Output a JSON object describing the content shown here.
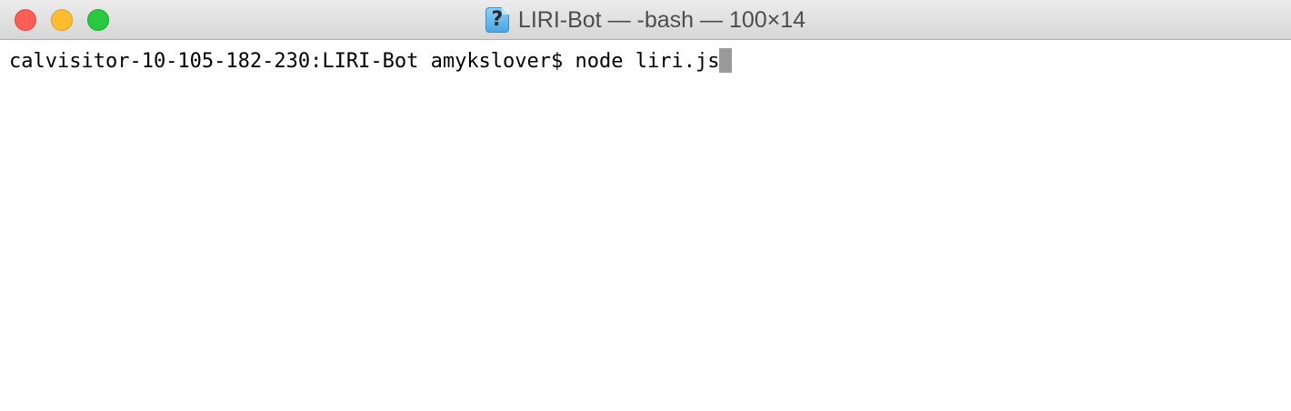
{
  "window": {
    "title": "LIRI-Bot — -bash — 100×14",
    "title_icon": "question-document-icon",
    "title_icon_glyph": "?"
  },
  "traffic_lights": {
    "close_color": "#fd5f57",
    "minimize_color": "#febc2e",
    "zoom_color": "#28c840"
  },
  "terminal": {
    "prompt": "calvisitor-10-105-182-230:LIRI-Bot amykslover$ ",
    "command": "node liri.js"
  }
}
